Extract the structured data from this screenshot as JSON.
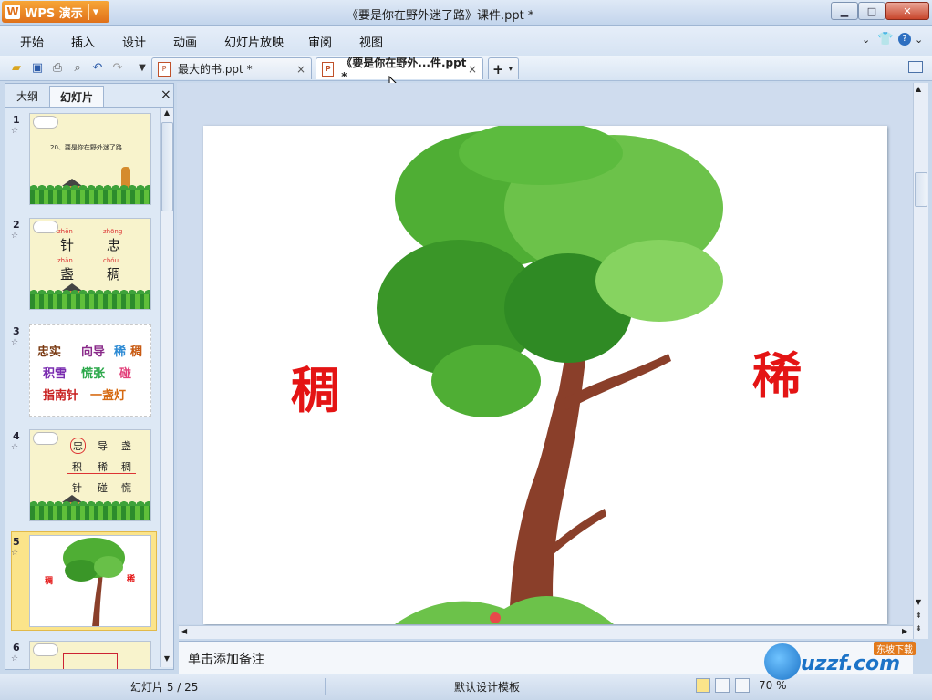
{
  "titlebar": {
    "app_label": "WPS 演示",
    "app_logo": "W",
    "window_title": "《要是你在野外迷了路》课件.ppt *",
    "minimize": "▁",
    "maximize": "□",
    "close": "✕"
  },
  "menu": {
    "items": [
      "开始",
      "插入",
      "设计",
      "动画",
      "幻灯片放映",
      "审阅",
      "视图"
    ]
  },
  "tabs": [
    {
      "label": "最大的书.ppt *",
      "close": "×",
      "active": false
    },
    {
      "label": "《要是你在野外...件.ppt *",
      "close": "×",
      "active": true
    }
  ],
  "new_tab": "+",
  "panel": {
    "tab_outline": "大纲",
    "tab_slides": "幻灯片",
    "close": "×",
    "slides": [
      {
        "num": "1",
        "star": "☆"
      },
      {
        "num": "2",
        "star": "☆"
      },
      {
        "num": "3",
        "star": "☆"
      },
      {
        "num": "4",
        "star": "☆"
      },
      {
        "num": "5",
        "star": "☆"
      },
      {
        "num": "6",
        "star": "☆"
      }
    ],
    "thumb1": {
      "title": "20、要是你在野外迷了路"
    },
    "thumb2": {
      "py1": "zhēn",
      "c1": "针",
      "py2": "zhōng",
      "c2": "忠",
      "py3": "zhǎn",
      "c3": "盏",
      "py4": "chóu",
      "c4": "稠"
    },
    "thumb3": {
      "line1a": "忠实",
      "line1b": "向导",
      "line1c": "稀",
      "line1d": "稠",
      "line2a": "积雪",
      "line2b": "慌张",
      "line2c": "碰",
      "line3a": "指南针",
      "line3b": "一盏灯"
    },
    "thumb4": {
      "r1": [
        "忠",
        "导",
        "盏"
      ],
      "r2": [
        "积",
        "稀",
        "稠"
      ],
      "r3": [
        "针",
        "碰",
        "慌"
      ]
    },
    "thumb5": {
      "left": "稠",
      "right": "稀"
    }
  },
  "slide": {
    "left_char": "稠",
    "right_char": "稀"
  },
  "notes": {
    "placeholder": "单击添加备注"
  },
  "status": {
    "slide_count": "幻灯片 5 / 25",
    "template": "默认设计模板",
    "zoom": "70 %"
  },
  "watermark": {
    "text": "uzzf.com",
    "tag": "东坡下载"
  },
  "colors": {
    "accent_orange": "#e0701a",
    "slide_char": "#e41414",
    "selected_thumb": "#fbe48a"
  }
}
